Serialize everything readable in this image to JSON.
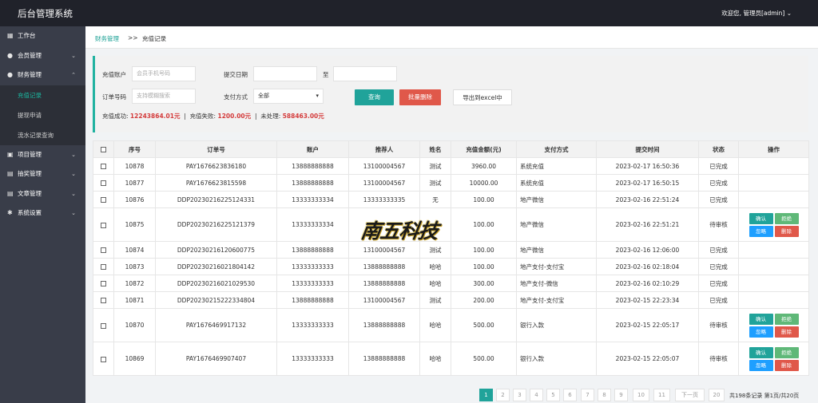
{
  "app": {
    "title": "后台管理系统",
    "user_menu": "欢迎您, 管理员[admin]"
  },
  "sidebar": {
    "items": [
      {
        "icon": "dashboard-icon",
        "label": "工作台",
        "expanded": false,
        "has_chevron": false
      },
      {
        "icon": "member-icon",
        "label": "会员管理",
        "expanded": false,
        "has_chevron": true
      },
      {
        "icon": "finance-icon",
        "label": "财务管理",
        "expanded": true,
        "has_chevron": true,
        "children": [
          {
            "label": "充值记录",
            "active": true
          },
          {
            "label": "提现申请",
            "active": false
          },
          {
            "label": "流水记录查询",
            "active": false
          }
        ]
      },
      {
        "icon": "project-icon",
        "label": "项目管理",
        "expanded": false,
        "has_chevron": true
      },
      {
        "icon": "lottery-icon",
        "label": "抽奖管理",
        "expanded": false,
        "has_chevron": true
      },
      {
        "icon": "article-icon",
        "label": "文章管理",
        "expanded": false,
        "has_chevron": true
      },
      {
        "icon": "settings-icon",
        "label": "系统设置",
        "expanded": false,
        "has_chevron": true
      }
    ]
  },
  "breadcrumb": {
    "parent": "财务管理",
    "sep": ">>",
    "current": "充值记录"
  },
  "filter": {
    "account_label": "充值账户",
    "account_placeholder": "会员手机号码",
    "date_label": "提交日期",
    "date_from": "",
    "date_sep": "至",
    "date_to": "",
    "order_label": "订单号码",
    "order_placeholder": "支持模糊搜索",
    "pay_label": "支付方式",
    "pay_value": "全部",
    "query_button": "查询",
    "batch_delete_button": "批量删除",
    "export_button": "导出到excel中",
    "stats": {
      "success_label": "充值成功:",
      "success_value": "12243864.01元",
      "fail_label": "充值失败:",
      "fail_value": "1200.00元",
      "pending_label": "未处理:",
      "pending_value": "588463.00元",
      "divider": "|"
    }
  },
  "table": {
    "headers": [
      "",
      "序号",
      "订单号",
      "账户",
      "推荐人",
      "姓名",
      "充值金额(元)",
      "支付方式",
      "提交时间",
      "状态",
      "操作"
    ],
    "rows": [
      {
        "id": "10878",
        "order": "PAY1676623836180",
        "account": "13888888888",
        "referrer": "13100004567",
        "name": "测试",
        "amount": "3960.00",
        "method": "系统充值",
        "time": "2023-02-17 16:50:36",
        "status": "已完成",
        "actions": false
      },
      {
        "id": "10877",
        "order": "PAY1676623815598",
        "account": "13888888888",
        "referrer": "13100004567",
        "name": "测试",
        "amount": "10000.00",
        "method": "系统充值",
        "time": "2023-02-17 16:50:15",
        "status": "已完成",
        "actions": false
      },
      {
        "id": "10876",
        "order": "DDP20230216225124331",
        "account": "13333333334",
        "referrer": "13333333335",
        "name": "无",
        "amount": "100.00",
        "method": "地产微信",
        "time": "2023-02-16 22:51:24",
        "status": "已完成",
        "actions": false
      },
      {
        "id": "10875",
        "order": "DDP20230216225121379",
        "account": "13333333334",
        "referrer": "",
        "name": "",
        "amount": "100.00",
        "method": "地产微信",
        "time": "2023-02-16 22:51:21",
        "status": "待审核",
        "actions": true
      },
      {
        "id": "10874",
        "order": "DDP20230216120600775",
        "account": "13888888888",
        "referrer": "13100004567",
        "name": "测试",
        "amount": "100.00",
        "method": "地产微信",
        "time": "2023-02-16 12:06:00",
        "status": "已完成",
        "actions": false
      },
      {
        "id": "10873",
        "order": "DDP20230216021804142",
        "account": "13333333333",
        "referrer": "13888888888",
        "name": "哈哈",
        "amount": "100.00",
        "method": "地产支付-支付宝",
        "time": "2023-02-16 02:18:04",
        "status": "已完成",
        "actions": false
      },
      {
        "id": "10872",
        "order": "DDP20230216021029530",
        "account": "13333333333",
        "referrer": "13888888888",
        "name": "哈哈",
        "amount": "300.00",
        "method": "地产支付-微信",
        "time": "2023-02-16 02:10:29",
        "status": "已完成",
        "actions": false
      },
      {
        "id": "10871",
        "order": "DDP20230215222334804",
        "account": "13888888888",
        "referrer": "13100004567",
        "name": "测试",
        "amount": "200.00",
        "method": "地产支付-支付宝",
        "time": "2023-02-15 22:23:34",
        "status": "已完成",
        "actions": false
      },
      {
        "id": "10870",
        "order": "PAY1676469917132",
        "account": "13333333333",
        "referrer": "13888888888",
        "name": "哈哈",
        "amount": "500.00",
        "method": "银行入款",
        "time": "2023-02-15 22:05:17",
        "status": "待审核",
        "actions": true
      },
      {
        "id": "10869",
        "order": "PAY1676469907407",
        "account": "13333333333",
        "referrer": "13888888888",
        "name": "哈哈",
        "amount": "500.00",
        "method": "银行入款",
        "time": "2023-02-15 22:05:07",
        "status": "待审核",
        "actions": true
      }
    ],
    "action_labels": {
      "confirm": "确认",
      "reject": "拒绝",
      "ignore": "忽略",
      "delete": "删除"
    }
  },
  "pagination": {
    "pages": [
      "1",
      "2",
      "3",
      "4",
      "5",
      "6",
      "7",
      "8",
      "9",
      "10",
      "11"
    ],
    "current": "1",
    "next": "下一页",
    "last": "20",
    "summary": "共198条记录 第1页/共20页"
  },
  "watermark": {
    "text": "南五科技"
  },
  "colors": {
    "accent": "#20a39a",
    "danger": "#e0584a",
    "sidebar": "#393d49",
    "topbar": "#20222a",
    "highlight": "#d43c3c"
  }
}
